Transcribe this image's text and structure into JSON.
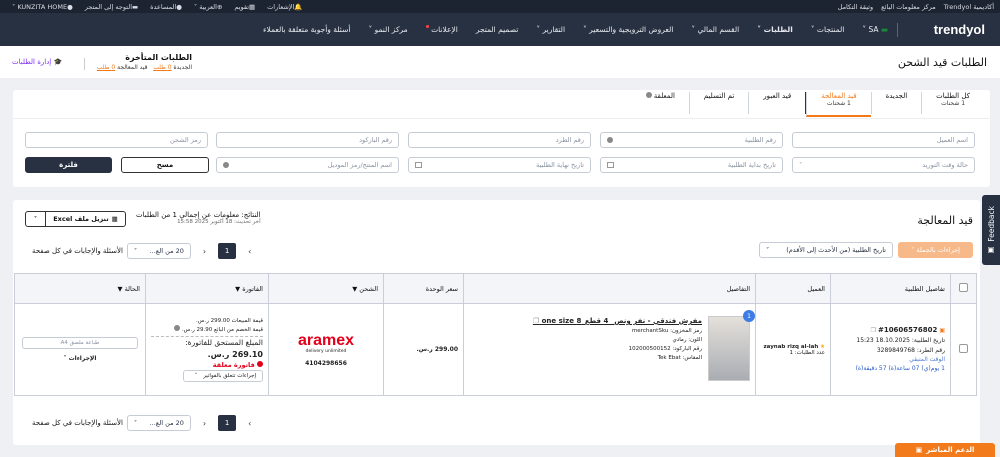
{
  "topbar": {
    "right": [
      "أكاديمية Trendyol",
      "مركز معلومات البائع",
      "وثيقة التكامل"
    ],
    "left": [
      "الإشعارات",
      "تقويم",
      "العربية",
      "المساعدة",
      "التوجه إلى المتجر",
      "KUNZITA HOME"
    ]
  },
  "nav": {
    "logo": "trendyol",
    "country": "SA",
    "items": [
      "المنتجات",
      "الطلبات",
      "القسم المالي",
      "العروض الترويجية والتسعير",
      "التقارير",
      "تصميم المتجر",
      "الإعلانات",
      "مركز النمو",
      "أسئلة وأجوبة متعلقة بالعملاء"
    ]
  },
  "header": {
    "title": "الطلبات قيد الشحن",
    "late_title": "الطلبات المتأخرة",
    "late_new_label": "الجديدة",
    "late_new_value": "0 طلب",
    "late_proc_label": "قيد المعالجة",
    "late_proc_value": "0 طلب",
    "manage": "إدارة الطلبات"
  },
  "tabs": [
    {
      "label": "كل الطلبات",
      "sub": "1 شحنات"
    },
    {
      "label": "الجديدة",
      "sub": ""
    },
    {
      "label": "قيد المعالجة",
      "sub": "1 شحنات"
    },
    {
      "label": "قيد العبور",
      "sub": ""
    },
    {
      "label": "تم التسليم",
      "sub": ""
    },
    {
      "label": "المعلقة",
      "sub": ""
    }
  ],
  "filters": {
    "customer": "اسم العميل",
    "order_no": "رقم الطلبية",
    "package_no": "رقم الطرد",
    "barcode": "رقم الباركود",
    "ship_code": "رمز الشحن",
    "supply_status": "حالة وقت التوريد",
    "start_date": "تاريخ بداية الطلبية",
    "end_date": "تاريخ نهاية الطلبية",
    "product": "اسم المنتج/رمز الموديل",
    "clear": "مسح",
    "filter": "فلترة"
  },
  "results": {
    "section": "قيد المعالجة",
    "info": "النتائج: معلومات عن إجمالي 1 من الطلبات",
    "updated": "آخر تحديث: 18 أكتوبر 2025 15:58",
    "excel": "تنزيل ملف Excel",
    "bulk": "إجراءات بالجملة",
    "sort": "تاريخ الطلبية (من الأحدث إلى الأقدم)",
    "per_page_label": "الأسئلة والإجابات في كل صفحة",
    "per_page": "20 من الع...",
    "page": "1"
  },
  "table": {
    "headers": [
      "تفاصيل الطلبية",
      "العميل",
      "التفاصيل",
      "سعر الوحدة",
      "الشحن",
      "الفاتورة",
      "الحالة"
    ],
    "row": {
      "order_no": "#10606576802",
      "order_date": "تاريخ الطلبية: 18.10.2025 15:23",
      "package": "رقم الطرد: 3289849768",
      "remaining_label": "الوقت المتبقي",
      "remaining": "1 يوم(ي) 07 ساعة(ة) 57 دقيقة(ة)",
      "customer": "zaynab rizq al-lah",
      "customer_orders": "عدد الطلبات: 1",
      "qty": "1",
      "product": "مفرش فندقي - نفر ونص_ 4 قطع_8 one size",
      "sku": "رمز المخزون: merchantSku",
      "color": "اللون: رمادي",
      "barcode": "رقم الباركود: 102000500152",
      "size": "المقاس: Tek Ebat",
      "price": "299.00 ر.س.",
      "carrier": "aramex",
      "carrier_tag": "delivery unlimited",
      "tracking": "4104298656",
      "inv_sales": "قيمة المبيعات 299.00 ر.س.",
      "inv_disc": "قيمة الخصم من البائع 29.90 ر.س.",
      "inv_due_label": "المبلغ المستحق للفاتورة:",
      "inv_due": "269.10 ر.س.",
      "inv_pending": "فاتورة معلقة",
      "inv_actions": "إجراءات تتعلق بالفواتير",
      "print": "طباعة ملصق A4",
      "actions": "الإجراءات"
    }
  },
  "feedback": "Feedback",
  "support": "الدعم المباشر",
  "colors": {
    "accent": "#f27a1a",
    "dark": "#273142"
  }
}
